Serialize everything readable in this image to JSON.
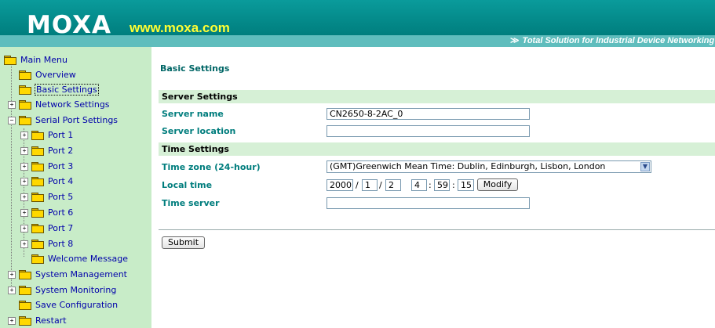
{
  "header": {
    "logo": "MOXA",
    "url": "www.moxa.com",
    "tagline_arrow": "≫",
    "tagline": "Total Solution for Industrial Device Networking"
  },
  "sidebar": {
    "items": [
      {
        "label": "Main Menu"
      },
      {
        "label": "Overview"
      },
      {
        "label": "Basic Settings"
      },
      {
        "label": "Network Settings"
      },
      {
        "label": "Serial Port Settings"
      },
      {
        "label": "Port 1"
      },
      {
        "label": "Port 2"
      },
      {
        "label": "Port 3"
      },
      {
        "label": "Port 4"
      },
      {
        "label": "Port 5"
      },
      {
        "label": "Port 6"
      },
      {
        "label": "Port 7"
      },
      {
        "label": "Port 8"
      },
      {
        "label": "Welcome Message"
      },
      {
        "label": "System Management"
      },
      {
        "label": "System Monitoring"
      },
      {
        "label": "Save Configuration"
      },
      {
        "label": "Restart"
      }
    ]
  },
  "main": {
    "title": "Basic Settings",
    "server_section": "Server Settings",
    "server_name_label": "Server name",
    "server_name_value": "CN2650-8-2AC_0",
    "server_location_label": "Server location",
    "server_location_value": "",
    "time_section": "Time Settings",
    "timezone_label": "Time zone (24-hour)",
    "timezone_value": "(GMT)Greenwich Mean Time: Dublin, Edinburgh, Lisbon, London",
    "local_time_label": "Local time",
    "local_time": {
      "year": "2000",
      "month": "1",
      "day": "2",
      "hour": "4",
      "minute": "59",
      "second": "15"
    },
    "date_sep": "/",
    "time_sep": ":",
    "modify_label": "Modify",
    "time_server_label": "Time server",
    "time_server_value": "",
    "submit_label": "Submit"
  }
}
